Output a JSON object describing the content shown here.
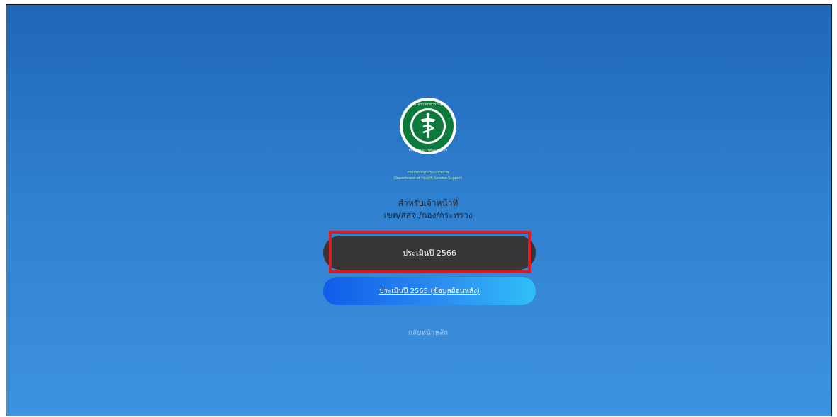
{
  "logo": {
    "icon": "ministry-of-public-health-seal-icon",
    "seal_text_top": "กระทรวงสาธารณสุข",
    "seal_text_bottom": "MINISTRY OF PUBLIC HEALTH"
  },
  "department": {
    "name_th": "กรมสนับสนุนบริการสุขภาพ",
    "name_en": "Department of Health Service Support"
  },
  "heading": {
    "line1": "สำหรับเจ้าหน้าที่",
    "line2": "เขต/สสจ./กอง/กระทรวง"
  },
  "buttons": {
    "year_2566": "ประเมินปี 2566",
    "year_2565": "ประเมินปี 2565 (ข้อมูลย้อนหลัง)"
  },
  "back_link": "กลับหน้าหลัก",
  "colors": {
    "background_top": "#1f66b6",
    "background_bottom": "#3d93e0",
    "dark_button": "#373634",
    "blue_button_start": "#0f5ce8",
    "blue_button_end": "#2fc0f7",
    "highlight": "#e0191e"
  }
}
